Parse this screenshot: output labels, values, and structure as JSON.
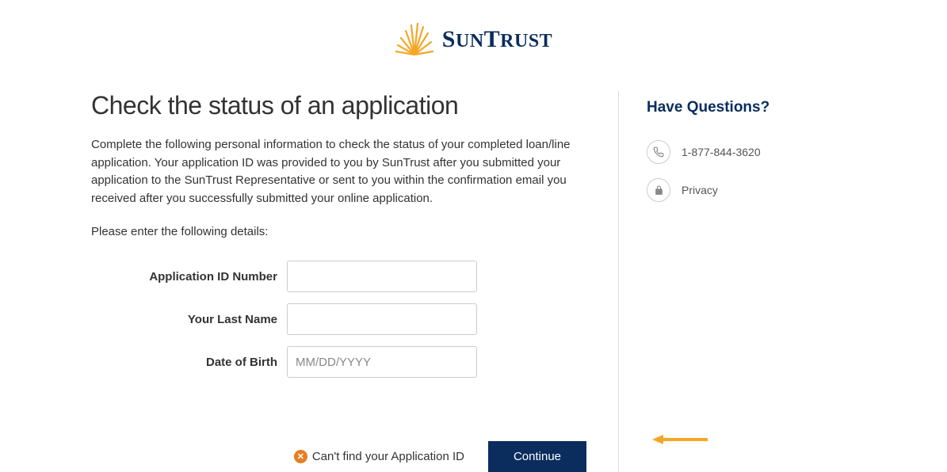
{
  "brand": {
    "name": "SunTrust"
  },
  "main": {
    "heading": "Check the status of an application",
    "description": "Complete the following personal information to check the status of your completed loan/line application. Your application ID was provided to you by SunTrust after you submitted your application to the SunTrust Representative or sent to you within the confirmation email you received after you successfully submitted your online application.",
    "prompt": "Please enter the following details:",
    "fields": {
      "app_id": {
        "label": "Application ID Number",
        "value": ""
      },
      "last_name": {
        "label": "Your Last Name",
        "value": ""
      },
      "dob": {
        "label": "Date of Birth",
        "placeholder": "MM/DD/YYYY",
        "value": ""
      }
    },
    "help_link": "Can't find your Application ID",
    "continue_label": "Continue"
  },
  "sidebar": {
    "heading": "Have Questions?",
    "phone": "1-877-844-3620",
    "privacy": "Privacy"
  }
}
